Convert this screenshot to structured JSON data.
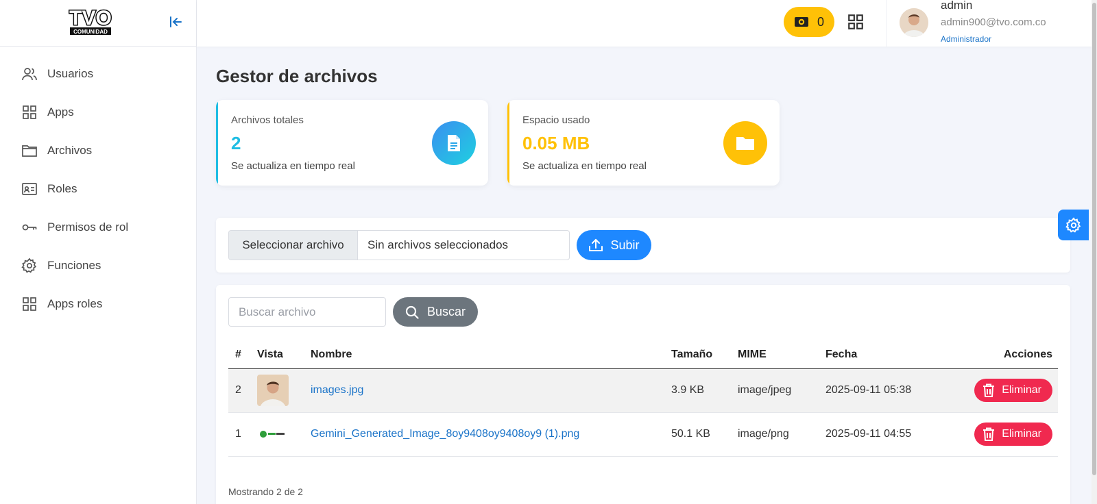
{
  "brand": {
    "logo_text_top": "TVO",
    "logo_text_bottom": "COMUNIDAD"
  },
  "sidebar": {
    "items": [
      {
        "label": "Usuarios",
        "icon": "users-icon"
      },
      {
        "label": "Apps",
        "icon": "grid-icon"
      },
      {
        "label": "Archivos",
        "icon": "folder-icon"
      },
      {
        "label": "Roles",
        "icon": "id-card-icon"
      },
      {
        "label": "Permisos de rol",
        "icon": "key-icon"
      },
      {
        "label": "Funciones",
        "icon": "gear-icon"
      },
      {
        "label": "Apps roles",
        "icon": "grid-icon"
      }
    ]
  },
  "topbar": {
    "views_count": "0",
    "user": {
      "name": "admin",
      "email": "admin900@tvo.com.co",
      "role": "Administrador"
    }
  },
  "main": {
    "title": "Gestor de archivos",
    "stats": [
      {
        "label": "Archivos totales",
        "value": "2",
        "sub": "Se actualiza en tiempo real",
        "accent": "#1fbde3"
      },
      {
        "label": "Espacio usado",
        "value": "0.05 MB",
        "sub": "Se actualiza en tiempo real",
        "accent": "#ffc107"
      }
    ],
    "upload": {
      "select_label": "Seleccionar archivo",
      "no_file_text": "Sin archivos seleccionados",
      "submit_label": "Subir"
    },
    "search": {
      "placeholder": "Buscar archivo",
      "button_label": "Buscar"
    },
    "table": {
      "headers": {
        "num": "#",
        "vista": "Vista",
        "nombre": "Nombre",
        "tamano": "Tamaño",
        "mime": "MIME",
        "fecha": "Fecha",
        "acciones": "Acciones"
      },
      "rows": [
        {
          "num": "2",
          "name": "images.jpg",
          "size": "3.9 KB",
          "mime": "image/jpeg",
          "date": "2025-09-11 05:38",
          "action": "Eliminar"
        },
        {
          "num": "1",
          "name": "Gemini_Generated_Image_8oy9408oy9408oy9 (1).png",
          "size": "50.1 KB",
          "mime": "image/png",
          "date": "2025-09-11 04:55",
          "action": "Eliminar"
        }
      ]
    },
    "footer_text": "Mostrando 2 de 2"
  },
  "colors": {
    "primary": "#1e88ff",
    "warning": "#ffc107",
    "danger": "#f0294f",
    "info": "#1fbde3",
    "secondary": "#6c757d"
  }
}
